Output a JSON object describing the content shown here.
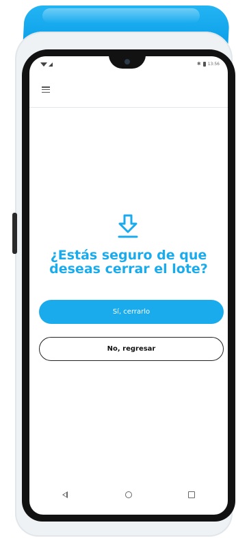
{
  "status_bar": {
    "time": "13:56",
    "icons": [
      "wifi-icon",
      "signal-icon",
      "bluetooth-icon",
      "battery-icon"
    ]
  },
  "header": {
    "menu_icon": "menu-icon"
  },
  "dialog": {
    "icon": "download-icon",
    "question": "¿Estás seguro de que deseas cerrar el lote?",
    "confirm_label": "Sí, cerrarlo",
    "cancel_label": "No, regresar"
  },
  "nav_bar": {
    "icons": [
      "back-icon",
      "home-icon",
      "recents-icon"
    ]
  },
  "colors": {
    "accent": "#1aabed",
    "printer": "#0fa2ea",
    "device_body": "#eef2f5",
    "bezel": "#121212"
  }
}
